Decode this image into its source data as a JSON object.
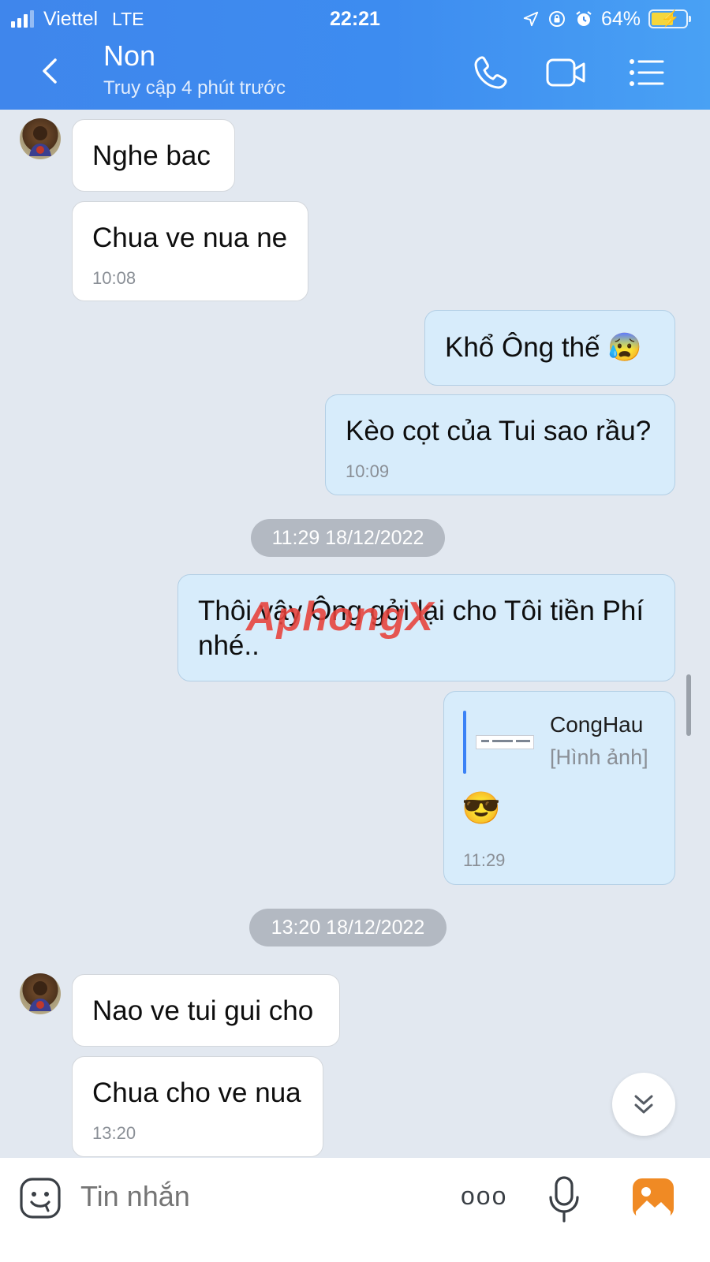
{
  "status_bar": {
    "carrier": "Viettel",
    "network": "LTE",
    "time": "22:21",
    "battery_pct": "64%",
    "battery_level": 0.64,
    "icons": [
      "location-arrow-icon",
      "orientation-lock-icon",
      "alarm-icon",
      "battery-charging-icon"
    ]
  },
  "header": {
    "contact_name": "Non",
    "last_seen": "Truy cập 4 phút trước",
    "icons": [
      "back-chevron-icon",
      "phone-call-icon",
      "video-call-icon",
      "menu-list-icon"
    ]
  },
  "messages": [
    {
      "side": "received",
      "text": "Nghe bac"
    },
    {
      "side": "received",
      "text": "Chua ve nua ne",
      "time": "10:08"
    },
    {
      "side": "sent",
      "text": "Khổ Ông thế",
      "emoji": "😰"
    },
    {
      "side": "sent",
      "text": "Kèo cọt của Tui sao rầu?",
      "time": "10:09"
    },
    {
      "side": "divider",
      "text": "11:29 18/12/2022"
    },
    {
      "side": "sent",
      "line1": "Thôi vậy Ông gởi lại cho Tôi tiền Phí",
      "line2": "nhé.."
    },
    {
      "side": "sent",
      "quote_name": "CongHau",
      "quote_type": "[Hình ảnh]",
      "emoji": "😎",
      "time": "11:29"
    },
    {
      "side": "divider",
      "text": "13:20 18/12/2022"
    },
    {
      "side": "received",
      "text": "Nao ve tui gui cho"
    },
    {
      "side": "received",
      "text": "Chua cho ve nua",
      "time": "13:20"
    }
  ],
  "watermark": {
    "main": "Aphong",
    "suffix": "X"
  },
  "input_bar": {
    "placeholder": "Tin nhắn",
    "more_glyph": "ooo",
    "icons": [
      "sticker-face-icon",
      "more-dots-icon",
      "microphone-icon",
      "gallery-image-icon"
    ]
  },
  "colors": {
    "header_blue": "#3d8cf0",
    "sent_bubble": "#d7ecfb",
    "chat_bg": "#e2e8f0",
    "gallery_orange": "#f08a24"
  }
}
